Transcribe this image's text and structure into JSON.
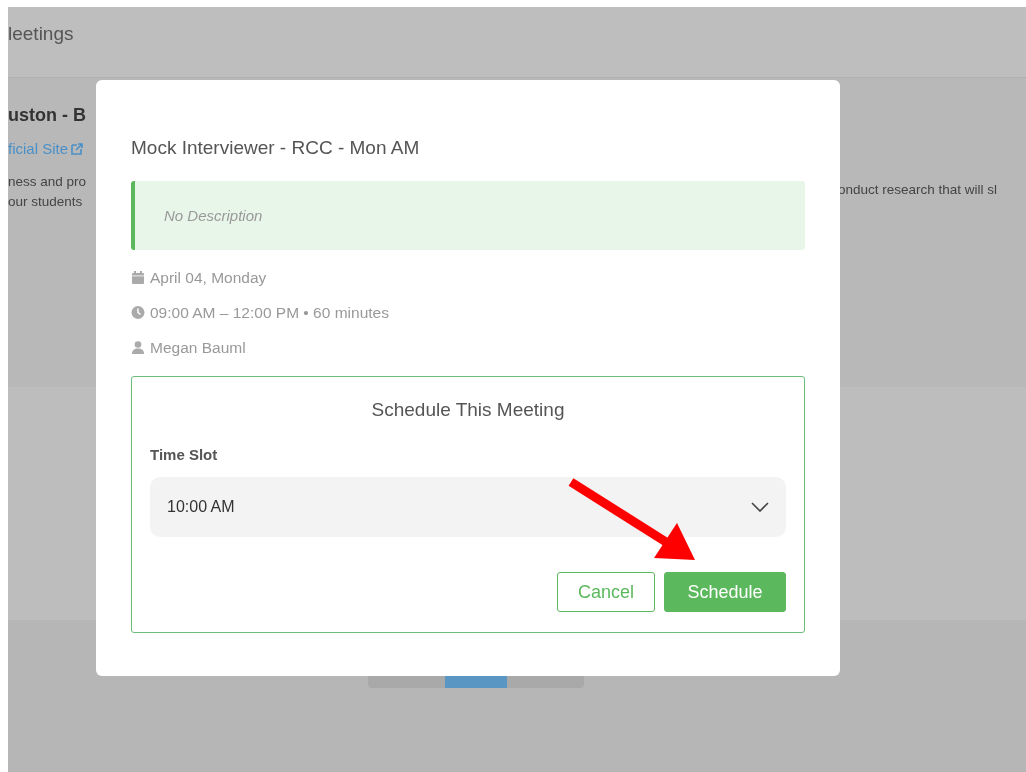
{
  "page": {
    "header_title": "leetings",
    "org_title": "uston - B",
    "site_link": "ficial Site",
    "description_left": [
      "ness and pro",
      "our students"
    ],
    "description_right": "onduct research that will sl",
    "pager": [
      {
        "selected": false
      },
      {
        "selected": true
      },
      {
        "selected": false
      }
    ]
  },
  "modal": {
    "title": "Mock Interviewer - RCC - Mon AM",
    "description": "No Description",
    "details": [
      {
        "kind": "date",
        "text": "April 04, Monday"
      },
      {
        "kind": "time",
        "text": "09:00 AM – 12:00 PM • 60 minutes"
      },
      {
        "kind": "person",
        "text": "Megan Bauml"
      }
    ],
    "schedule": {
      "heading": "Schedule This Meeting",
      "field_label": "Time Slot",
      "value": "10:00 AM",
      "buttons": [
        {
          "label": "Cancel",
          "kind": "secondary"
        },
        {
          "label": "Schedule",
          "kind": "primary"
        }
      ]
    }
  }
}
